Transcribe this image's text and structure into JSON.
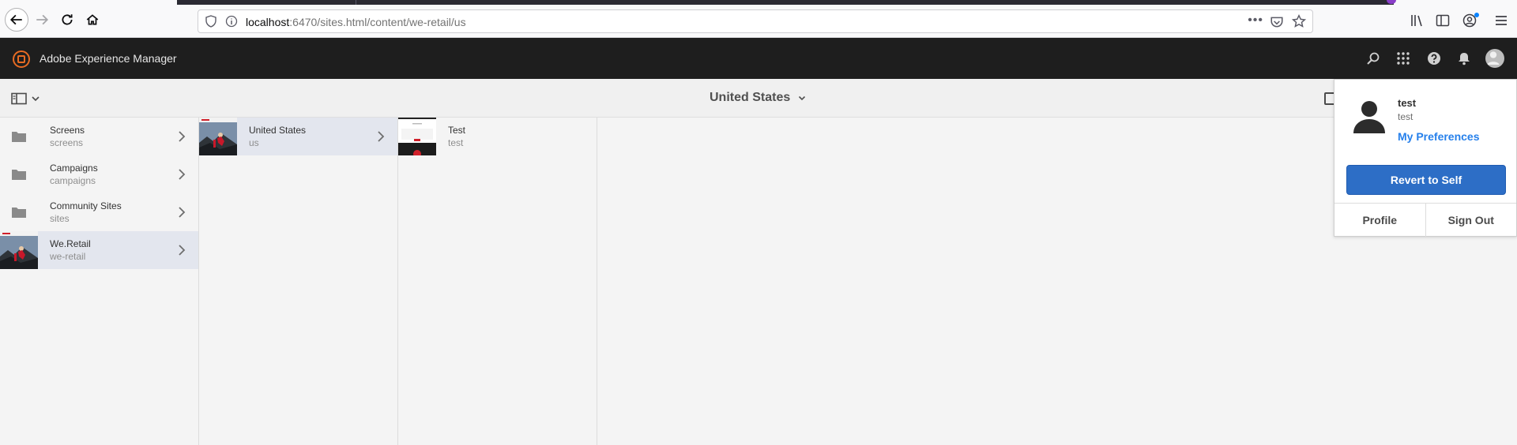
{
  "browser": {
    "url_host": "localhost",
    "url_rest": ":6470/sites.html/content/we-retail/us",
    "more_label": "•••"
  },
  "app": {
    "title": "Adobe Experience Manager"
  },
  "action_bar": {
    "heading": "United States"
  },
  "columns": {
    "root": [
      {
        "title": "Screens",
        "name": "screens",
        "thumb": "folder"
      },
      {
        "title": "Campaigns",
        "name": "campaigns",
        "thumb": "folder"
      },
      {
        "title": "Community Sites",
        "name": "sites",
        "thumb": "folder"
      },
      {
        "title": "We.Retail",
        "name": "we-retail",
        "thumb": "image",
        "active": true
      }
    ],
    "we_retail": [
      {
        "title": "United States",
        "name": "us",
        "thumb": "image",
        "active": true
      }
    ],
    "us": [
      {
        "title": "Test",
        "name": "test",
        "thumb": "page"
      }
    ]
  },
  "profile_popover": {
    "user_name": "test",
    "user_id": "test",
    "preferences_link": "My Preferences",
    "revert_button": "Revert to Self",
    "profile_button": "Profile",
    "signout_button": "Sign Out"
  },
  "colors": {
    "header_bg": "#1e1e1e",
    "accent_blue": "#2d6ec6",
    "link_blue": "#2680eb",
    "logo_orange": "#e76b23",
    "active_row": "#e3e6ee"
  }
}
